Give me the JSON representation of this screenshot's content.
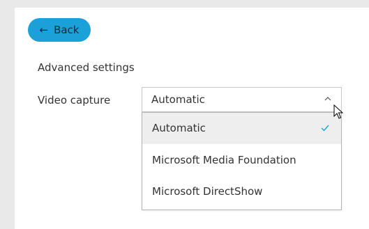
{
  "back_button": {
    "label": "Back",
    "icon": "arrow-left-icon",
    "color": "#1ba1d8"
  },
  "settings": {
    "title": "Advanced settings",
    "video_capture": {
      "label": "Video capture",
      "selected_value": "Automatic",
      "expanded": true,
      "options": [
        {
          "label": "Automatic",
          "selected": true
        },
        {
          "label": "Microsoft Media Foundation",
          "selected": false
        },
        {
          "label": "Microsoft DirectShow",
          "selected": false
        }
      ]
    }
  },
  "icons": {
    "chevron": "chevron-up-icon",
    "check": "checkmark-icon",
    "check_color": "#1ba1d8"
  }
}
